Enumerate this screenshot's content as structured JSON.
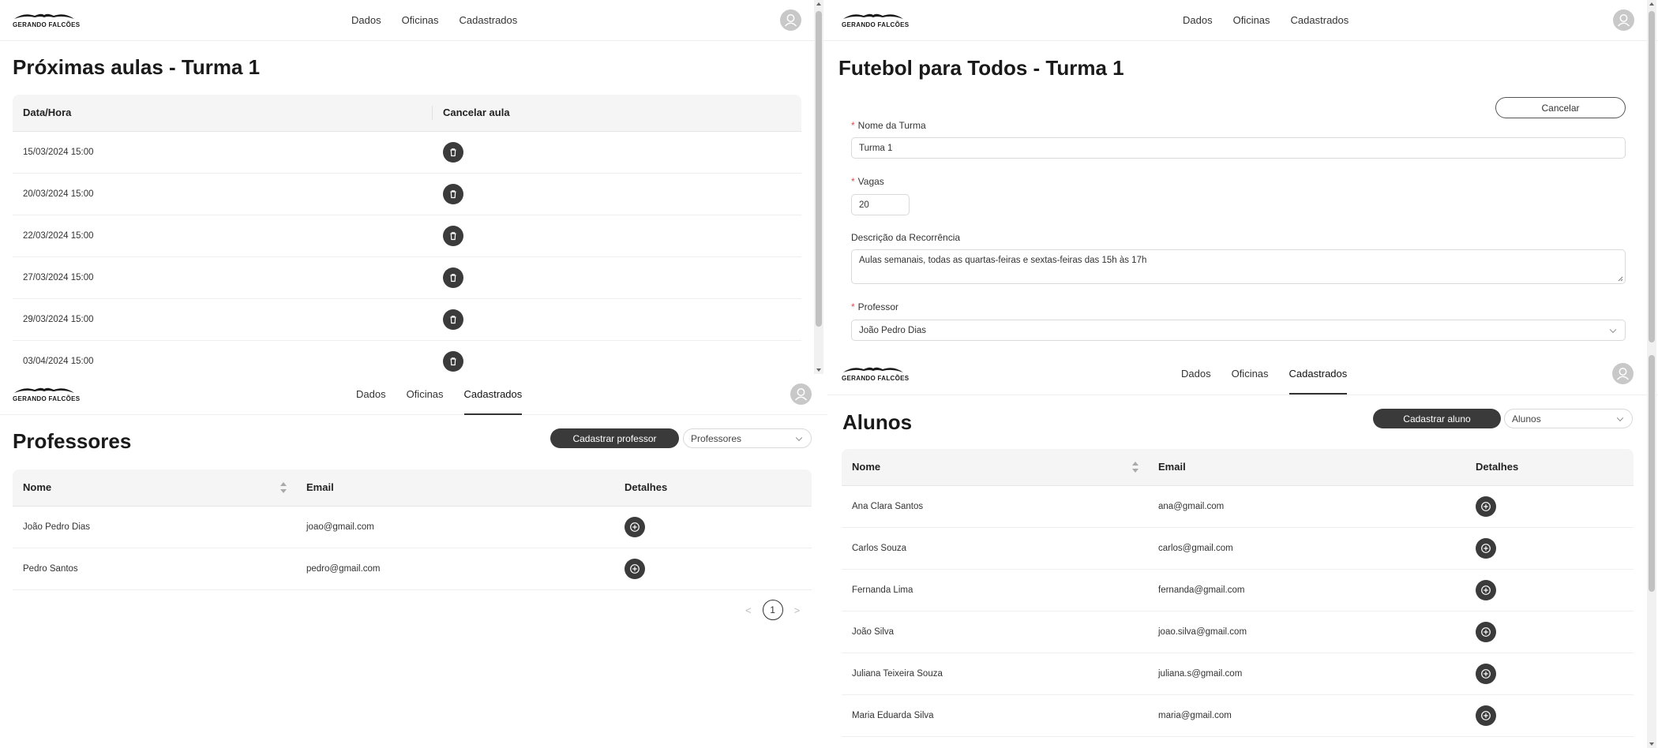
{
  "brand": {
    "logo_text": "GERANDO FALCÕES"
  },
  "nav": {
    "dados": "Dados",
    "oficinas": "Oficinas",
    "cadastrados": "Cadastrados"
  },
  "aulas_panel": {
    "title": "Próximas aulas - Turma 1",
    "columns": {
      "datetime": "Data/Hora",
      "cancel": "Cancelar aula"
    },
    "rows": [
      {
        "datetime": "15/03/2024 15:00"
      },
      {
        "datetime": "20/03/2024 15:00"
      },
      {
        "datetime": "22/03/2024 15:00"
      },
      {
        "datetime": "27/03/2024 15:00"
      },
      {
        "datetime": "29/03/2024 15:00"
      },
      {
        "datetime": "03/04/2024 15:00"
      }
    ]
  },
  "turma_form": {
    "title": "Futebol para Todos - Turma 1",
    "cancel_label": "Cancelar",
    "nome_label": "Nome da Turma",
    "nome_value": "Turma 1",
    "vagas_label": "Vagas",
    "vagas_value": "20",
    "descricao_label": "Descrição da Recorrência",
    "descricao_value": "Aulas semanais, todas as quartas-feiras e sextas-feiras das 15h às 17h",
    "professor_label": "Professor",
    "professor_value": "João Pedro Dias",
    "required_mark": "*"
  },
  "professores_panel": {
    "title": "Professores",
    "add_label": "Cadastrar professor",
    "filter_value": "Professores",
    "columns": {
      "nome": "Nome",
      "email": "Email",
      "detalhes": "Detalhes"
    },
    "rows": [
      {
        "nome": "João Pedro Dias",
        "email": "joao@gmail.com"
      },
      {
        "nome": "Pedro Santos",
        "email": "pedro@gmail.com"
      }
    ],
    "pagination": {
      "current_page": "1",
      "prev": "<",
      "next": ">"
    }
  },
  "alunos_panel": {
    "title": "Alunos",
    "add_label": "Cadastrar aluno",
    "filter_value": "Alunos",
    "columns": {
      "nome": "Nome",
      "email": "Email",
      "detalhes": "Detalhes"
    },
    "rows": [
      {
        "nome": "Ana Clara Santos",
        "email": "ana@gmail.com"
      },
      {
        "nome": "Carlos Souza",
        "email": "carlos@gmail.com"
      },
      {
        "nome": "Fernanda Lima",
        "email": "fernanda@gmail.com"
      },
      {
        "nome": "João Silva",
        "email": "joao.silva@gmail.com"
      },
      {
        "nome": "Juliana Teixeira Souza",
        "email": "juliana.s@gmail.com"
      },
      {
        "nome": "Maria Eduarda Silva",
        "email": "maria@gmail.com"
      }
    ]
  },
  "colors": {
    "dark_button": "#3a3a3a",
    "header_bg": "#f5f5f5",
    "required": "#e34d4d",
    "avatar": "#c8c8c8"
  }
}
